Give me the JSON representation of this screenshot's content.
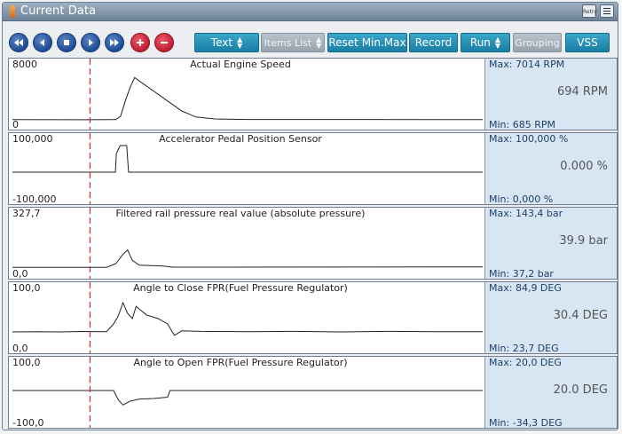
{
  "window": {
    "title": "Current Data"
  },
  "title_bar": {
    "retry_label": "Retry",
    "menu_icon": "menu-lines-icon"
  },
  "toolbar": {
    "nav": [
      {
        "name": "first-record-button",
        "icon": "double-left-icon"
      },
      {
        "name": "previous-record-button",
        "icon": "left-icon"
      },
      {
        "name": "stop-button",
        "icon": "stop-icon"
      },
      {
        "name": "next-record-button",
        "icon": "right-icon"
      },
      {
        "name": "last-record-button",
        "icon": "double-right-icon"
      },
      {
        "name": "zoom-in-button",
        "icon": "plus-icon"
      },
      {
        "name": "zoom-out-button",
        "icon": "minus-icon"
      }
    ],
    "text_label": "Text",
    "items_list_label": "Items List",
    "reset_label": "Reset Min.Max",
    "record_label": "Record",
    "run_label": "Run",
    "grouping_label": "Grouping",
    "vss_label": "VSS"
  },
  "colors": {
    "accent": "#1f84ab",
    "cursor_line": "#d62828",
    "side_panel": "#d7e6f2"
  },
  "cursor": {
    "fraction": 0.165
  },
  "panels": [
    {
      "title": "Actual Engine Speed",
      "y_max_label": "8000",
      "y_min_label": "0",
      "max_text": "Max:  7014 RPM",
      "min_text": "Min:    685 RPM",
      "current_text": "694 RPM",
      "y_range": [
        0,
        8000
      ],
      "series": [
        [
          0,
          690
        ],
        [
          0.15,
          685
        ],
        [
          0.22,
          700
        ],
        [
          0.23,
          1200
        ],
        [
          0.24,
          3500
        ],
        [
          0.25,
          5500
        ],
        [
          0.26,
          7014
        ],
        [
          0.27,
          6500
        ],
        [
          0.3,
          5000
        ],
        [
          0.33,
          3500
        ],
        [
          0.36,
          2000
        ],
        [
          0.39,
          1100
        ],
        [
          0.43,
          800
        ],
        [
          0.5,
          720
        ],
        [
          1,
          694
        ]
      ]
    },
    {
      "title": "Accelerator Pedal Position Sensor",
      "y_max_label": "100,000",
      "y_min_label": "-100,000",
      "max_text": "Max: 100,000 %",
      "min_text": "Min:  0,000 %",
      "current_text": "0.000 %",
      "y_range": [
        -100,
        100
      ],
      "series": [
        [
          0,
          0
        ],
        [
          0.219,
          0
        ],
        [
          0.221,
          70
        ],
        [
          0.229,
          100
        ],
        [
          0.243,
          100
        ],
        [
          0.247,
          0
        ],
        [
          1,
          0
        ]
      ]
    },
    {
      "title": "Filtered rail pressure real value (absolute pressure)",
      "y_max_label": "327,7",
      "y_min_label": "0,0",
      "max_text": "Max: 143,4 bar",
      "min_text": "Min:   37,2 bar",
      "current_text": "39.9 bar",
      "y_range": [
        0,
        327.7
      ],
      "series": [
        [
          0,
          37
        ],
        [
          0.2,
          37.2
        ],
        [
          0.22,
          60
        ],
        [
          0.236,
          120
        ],
        [
          0.245,
          143
        ],
        [
          0.255,
          80
        ],
        [
          0.27,
          50
        ],
        [
          0.32,
          45
        ],
        [
          0.34,
          38
        ],
        [
          1,
          39.9
        ]
      ]
    },
    {
      "title": "Angle to Close FPR(Fuel Pressure Regulator)",
      "y_max_label": "100,0",
      "y_min_label": "0,0",
      "max_text": "Max:  84,9 DEG",
      "min_text": "Min:   23,7 DEG",
      "current_text": "30.4 DEG",
      "y_range": [
        0,
        100
      ],
      "series": [
        [
          0,
          30
        ],
        [
          0.05,
          30.5
        ],
        [
          0.1,
          30
        ],
        [
          0.15,
          30.8
        ],
        [
          0.2,
          30.3
        ],
        [
          0.215,
          45
        ],
        [
          0.225,
          60
        ],
        [
          0.235,
          84.9
        ],
        [
          0.245,
          65
        ],
        [
          0.255,
          55
        ],
        [
          0.263,
          78
        ],
        [
          0.285,
          62
        ],
        [
          0.31,
          55
        ],
        [
          0.33,
          45
        ],
        [
          0.34,
          30
        ],
        [
          0.345,
          23.7
        ],
        [
          0.36,
          32
        ],
        [
          0.4,
          31
        ],
        [
          0.5,
          30.5
        ],
        [
          0.6,
          31
        ],
        [
          0.7,
          30
        ],
        [
          0.8,
          31
        ],
        [
          0.9,
          30.5
        ],
        [
          1,
          30.4
        ]
      ]
    },
    {
      "title": "Angle to Open FPR(Fuel Pressure Regulator)",
      "y_max_label": "100,0",
      "y_min_label": "-100,0",
      "max_text": "Max:  20,0 DEG",
      "min_text": "Min:  -34,3 DEG",
      "current_text": "20.0 DEG",
      "y_range": [
        -100,
        100
      ],
      "series": [
        [
          0,
          20
        ],
        [
          0.215,
          20
        ],
        [
          0.225,
          -15
        ],
        [
          0.235,
          -34.3
        ],
        [
          0.25,
          -20
        ],
        [
          0.27,
          -12
        ],
        [
          0.3,
          -10
        ],
        [
          0.33,
          -5
        ],
        [
          0.335,
          20
        ],
        [
          1,
          20
        ]
      ]
    }
  ]
}
